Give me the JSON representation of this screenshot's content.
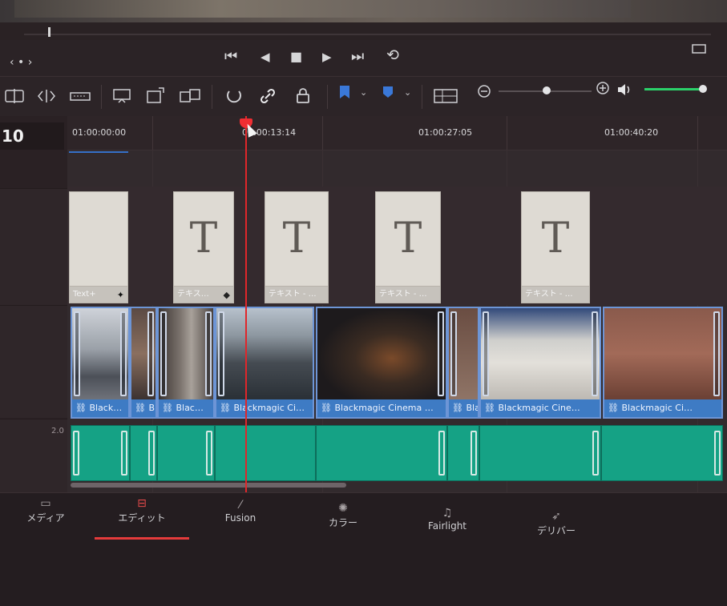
{
  "transport": {
    "nav_left": "‹ • ›",
    "first": "⏮",
    "prev": "◀",
    "stop": "■",
    "play": "▶",
    "last": "⏭",
    "loop": "⟲"
  },
  "toolbar": {
    "volume_level": 0.85,
    "flag_color": "#3a78d8",
    "marker_color": "#3a78d8",
    "audio_meter_color": "#2bd16a"
  },
  "track_headers": {
    "timecode": "10",
    "audio_level_label": "2.0"
  },
  "ruler": {
    "timecodes": [
      "01:00:00:00",
      "01:00:13:14",
      "01:00:27:05",
      "01:00:40:20"
    ]
  },
  "text_clips": [
    {
      "title": "Text+",
      "icon": "sparkle-icon",
      "glyph": ""
    },
    {
      "title": "テキス…",
      "icon": "diamond-icon",
      "glyph": "T"
    },
    {
      "title": "テキスト - …",
      "icon": "",
      "glyph": "T"
    },
    {
      "title": "テキスト - …",
      "icon": "",
      "glyph": "T"
    },
    {
      "title": "テキスト - …",
      "icon": "",
      "glyph": "T"
    }
  ],
  "video_clips": [
    {
      "name": "Black…"
    },
    {
      "name": "Bl…"
    },
    {
      "name": "Blac…"
    },
    {
      "name": "Blackmagic Ci…"
    },
    {
      "name": "Blackmagic Cinema …"
    },
    {
      "name": "Bla…"
    },
    {
      "name": "Blackmagic Cine…"
    },
    {
      "name": "Blackmagic Ci…"
    }
  ],
  "pages": [
    {
      "label": "メディア",
      "icon": "media-icon"
    },
    {
      "label": "エディット",
      "icon": "edit-icon",
      "active": true
    },
    {
      "label": "Fusion",
      "icon": "fusion-icon"
    },
    {
      "label": "カラー",
      "icon": "color-icon"
    },
    {
      "label": "Fairlight",
      "icon": "fairlight-icon"
    },
    {
      "label": "デリバー",
      "icon": "deliver-icon"
    }
  ]
}
